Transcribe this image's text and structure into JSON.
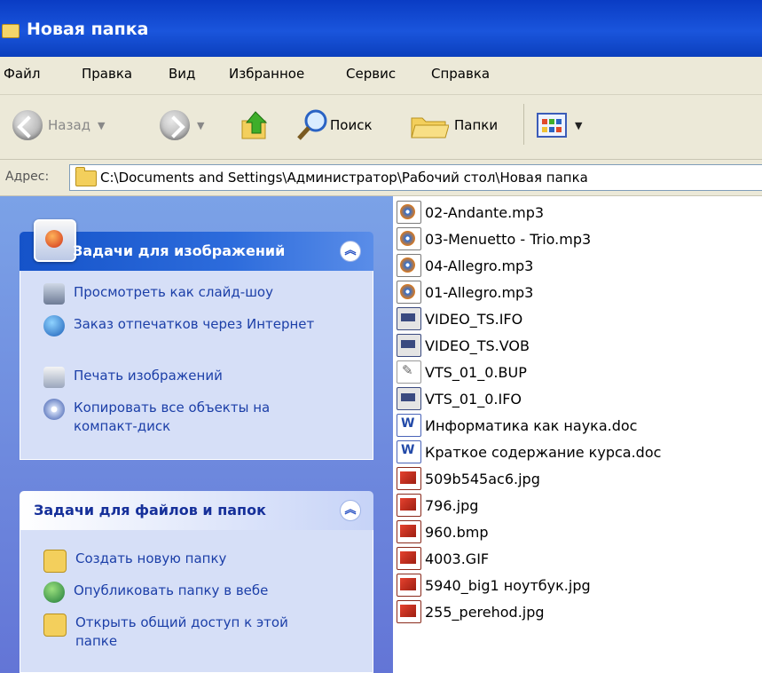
{
  "window": {
    "title": "Новая папка",
    "icon": "folder-icon"
  },
  "menu": [
    "Файл",
    "Правка",
    "Вид",
    "Избранное",
    "Сервис",
    "Справка"
  ],
  "toolbar": {
    "back_label": "Назад",
    "search_label": "Поиск",
    "folders_label": "Папки"
  },
  "address": {
    "label": "Адрес:",
    "path": "C:\\Documents and Settings\\Администратор\\Рабочий стол\\Новая папка"
  },
  "image_tasks": {
    "title": "Задачи для изображений",
    "items": [
      "Просмотреть как слайд-шоу",
      "Заказ отпечатков через Интернет",
      "Печать изображений",
      "Копировать все объекты на компакт-диск"
    ]
  },
  "file_tasks": {
    "title": "Задачи для файлов и папок",
    "items": [
      "Создать новую папку",
      "Опубликовать папку в вебе",
      "Открыть общий доступ к этой папке"
    ]
  },
  "files": [
    {
      "name": "02-Andante.mp3",
      "type": "mp3"
    },
    {
      "name": "03-Menuetto - Trio.mp3",
      "type": "mp3"
    },
    {
      "name": "04-Allegro.mp3",
      "type": "mp3"
    },
    {
      "name": "01-Allegro.mp3",
      "type": "mp3"
    },
    {
      "name": "VIDEO_TS.IFO",
      "type": "video"
    },
    {
      "name": "VIDEO_TS.VOB",
      "type": "video"
    },
    {
      "name": "VTS_01_0.BUP",
      "type": "bup"
    },
    {
      "name": "VTS_01_0.IFO",
      "type": "video"
    },
    {
      "name": "Информатика как наука.doc",
      "type": "doc"
    },
    {
      "name": "Краткое содержание курса.doc",
      "type": "doc"
    },
    {
      "name": "509b545ac6.jpg",
      "type": "img"
    },
    {
      "name": "796.jpg",
      "type": "img"
    },
    {
      "name": "960.bmp",
      "type": "img"
    },
    {
      "name": "4003.GIF",
      "type": "img"
    },
    {
      "name": "5940_big1 ноутбук.jpg",
      "type": "img"
    },
    {
      "name": "255_perehod.jpg",
      "type": "img"
    }
  ]
}
